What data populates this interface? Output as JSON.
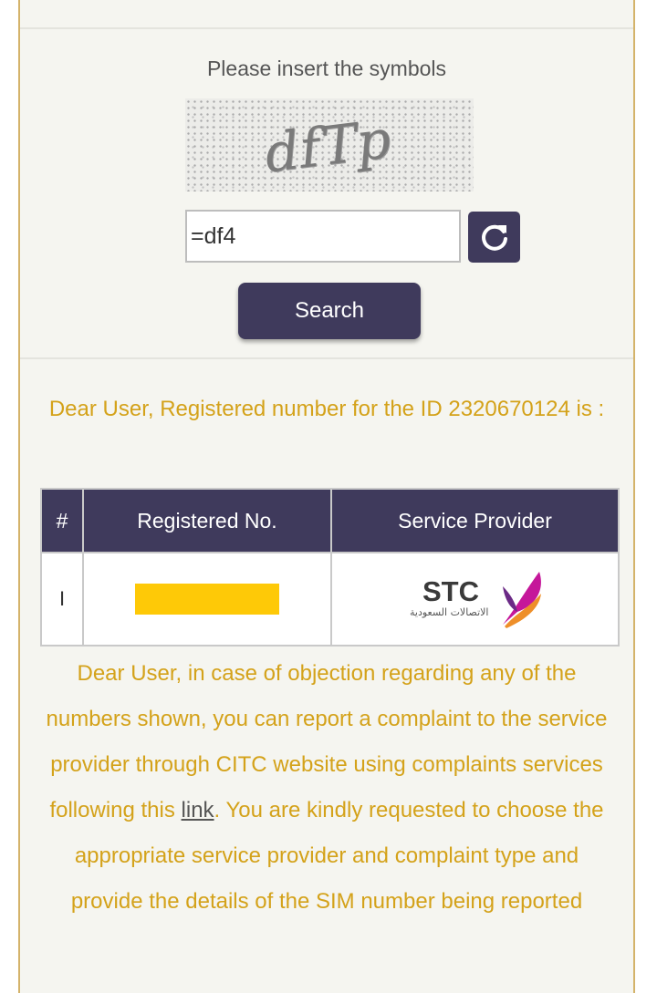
{
  "captcha": {
    "prompt": "Please insert the symbols",
    "image_text": "dfTp",
    "input_value": "=df4",
    "refresh_icon": "refresh-icon"
  },
  "search": {
    "label": "Search"
  },
  "result": {
    "message": "Dear User, Registered number for the ID 2320670124 is :"
  },
  "table": {
    "headers": [
      "#",
      "Registered No.",
      "Service Provider"
    ],
    "rows": [
      {
        "index": "I",
        "registered_no": "",
        "provider_logo": "stc-logo",
        "provider_name": "STC",
        "provider_arabic": "الاتصالات السعودية"
      }
    ]
  },
  "info": {
    "text_before": "Dear User, in case of objection regarding any of the numbers shown, you can report a complaint to the service provider through CITC website using complaints services following this ",
    "link_text": "link",
    "text_after": ". You are kindly requested to choose the appropriate service provider and complaint type and provide the details of the SIM number being reported"
  },
  "colors": {
    "primary": "#3f3a5c",
    "accent_text": "#d4a21a",
    "masked": "#fec907",
    "border": "#d4b36a",
    "background": "#f5f5f0"
  }
}
